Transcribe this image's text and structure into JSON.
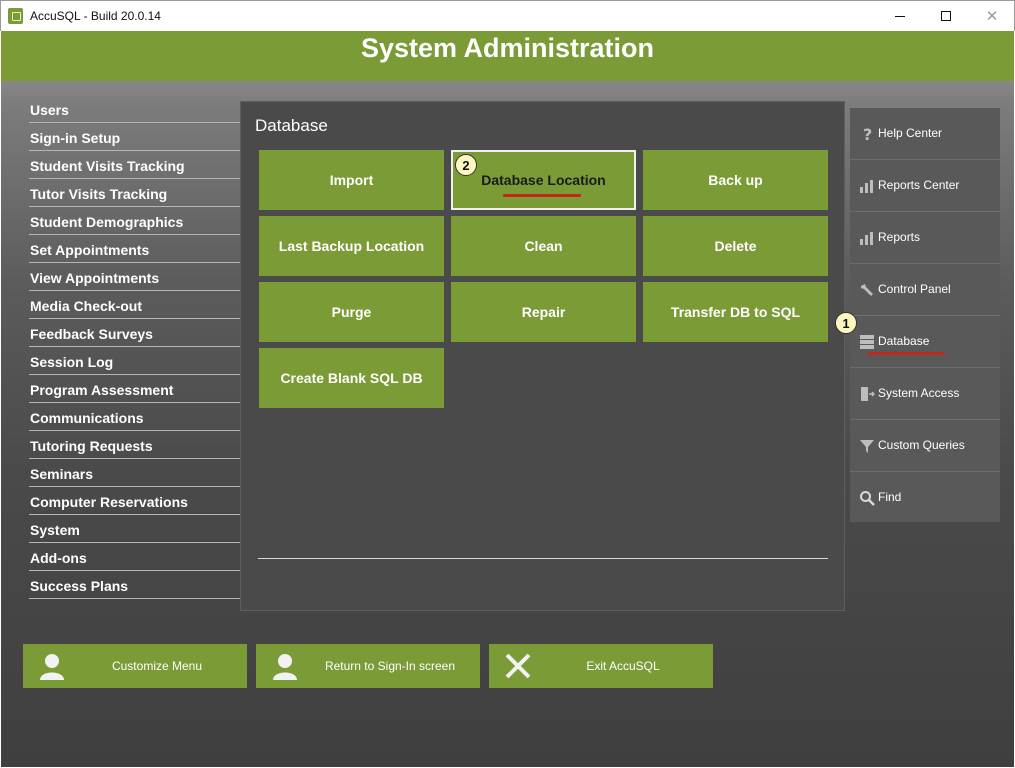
{
  "window": {
    "title": "AccuSQL - Build 20.0.14"
  },
  "header": {
    "title": "System Administration"
  },
  "left_menu": {
    "items": [
      {
        "label": "Users"
      },
      {
        "label": "Sign-in Setup"
      },
      {
        "label": "Student Visits Tracking"
      },
      {
        "label": "Tutor Visits Tracking"
      },
      {
        "label": "Student Demographics"
      },
      {
        "label": "Set Appointments"
      },
      {
        "label": "View Appointments"
      },
      {
        "label": "Media Check-out"
      },
      {
        "label": "Feedback Surveys"
      },
      {
        "label": "Session Log"
      },
      {
        "label": "Program Assessment"
      },
      {
        "label": "Communications"
      },
      {
        "label": "Tutoring Requests"
      },
      {
        "label": "Seminars"
      },
      {
        "label": "Computer Reservations"
      },
      {
        "label": "System"
      },
      {
        "label": "Add-ons"
      },
      {
        "label": "Success Plans"
      }
    ]
  },
  "panel": {
    "title": "Database",
    "buttons": [
      {
        "label": "Import"
      },
      {
        "label": "Database Location",
        "selected": true
      },
      {
        "label": "Back up"
      },
      {
        "label": "Last Backup Location"
      },
      {
        "label": "Clean"
      },
      {
        "label": "Delete"
      },
      {
        "label": "Purge"
      },
      {
        "label": "Repair"
      },
      {
        "label": "Transfer DB to SQL"
      },
      {
        "label": "Create Blank SQL DB"
      }
    ]
  },
  "right_menu": {
    "items": [
      {
        "label": "Help Center",
        "icon": "question-icon"
      },
      {
        "label": "Reports Center",
        "icon": "bar-chart-icon"
      },
      {
        "label": "Reports",
        "icon": "bar-chart-icon"
      },
      {
        "label": "Control Panel",
        "icon": "wrench-icon"
      },
      {
        "label": "Database",
        "icon": "database-icon",
        "active": true
      },
      {
        "label": "System Access",
        "icon": "door-icon"
      },
      {
        "label": "Custom Queries",
        "icon": "filter-icon"
      },
      {
        "label": "Find",
        "icon": "magnifier-icon"
      }
    ]
  },
  "markers": {
    "step1": "1",
    "step2": "2"
  },
  "bottom_buttons": {
    "customize": "Customize Menu",
    "return_signin": "Return to Sign-In screen",
    "exit": "Exit AccuSQL"
  },
  "colors": {
    "accent_green": "#7a9b36",
    "annotation_red": "#c0281e",
    "marker_yellow": "#fff7c0"
  }
}
